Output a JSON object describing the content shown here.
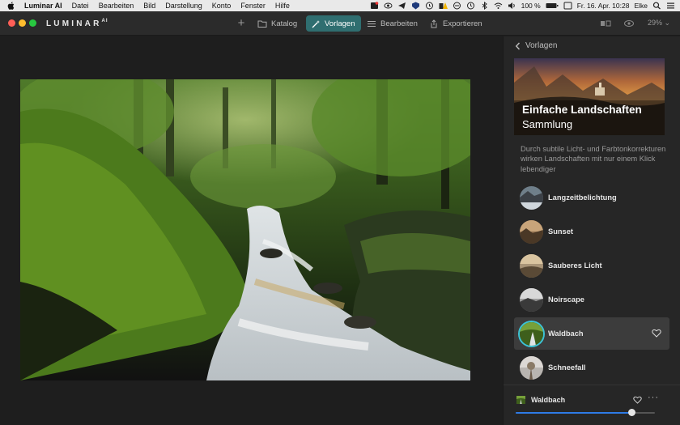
{
  "menubar": {
    "items": [
      "Luminar AI",
      "Datei",
      "Bearbeiten",
      "Bild",
      "Darstellung",
      "Konto",
      "Fenster",
      "Hilfe"
    ],
    "battery": "100 %",
    "clock": "Fr. 16. Apr. 10:28",
    "user": "Elke"
  },
  "toolbar": {
    "logo": "LUMINAR",
    "logo_sup": "AI",
    "plus": "+",
    "katalog": "Katalog",
    "vorlagen": "Vorlagen",
    "bearbeiten": "Bearbeiten",
    "exportieren": "Exportieren",
    "zoom": "29%"
  },
  "panel": {
    "back_label": "Vorlagen",
    "collection_title": "Einfache Landschaften",
    "collection_subtitle": "Sammlung",
    "description": "Durch subtile Licht- und Farbtonkorrekturen wirken Landschaften mit nur einem Klick lebendiger",
    "presets": [
      {
        "label": "Langzeitbelichtung",
        "active": false
      },
      {
        "label": "Sunset",
        "active": false
      },
      {
        "label": "Sauberes Licht",
        "active": false
      },
      {
        "label": "Noirscape",
        "active": false
      },
      {
        "label": "Waldbach",
        "active": true
      },
      {
        "label": "Schneefall",
        "active": false
      }
    ],
    "footer": {
      "label": "Waldbach",
      "more": "···",
      "amount": 0.83
    }
  },
  "colors": {
    "accent_teal": "#2f6e70",
    "active_ring": "#3cc3d6",
    "slider_blue": "#2e7be6"
  }
}
